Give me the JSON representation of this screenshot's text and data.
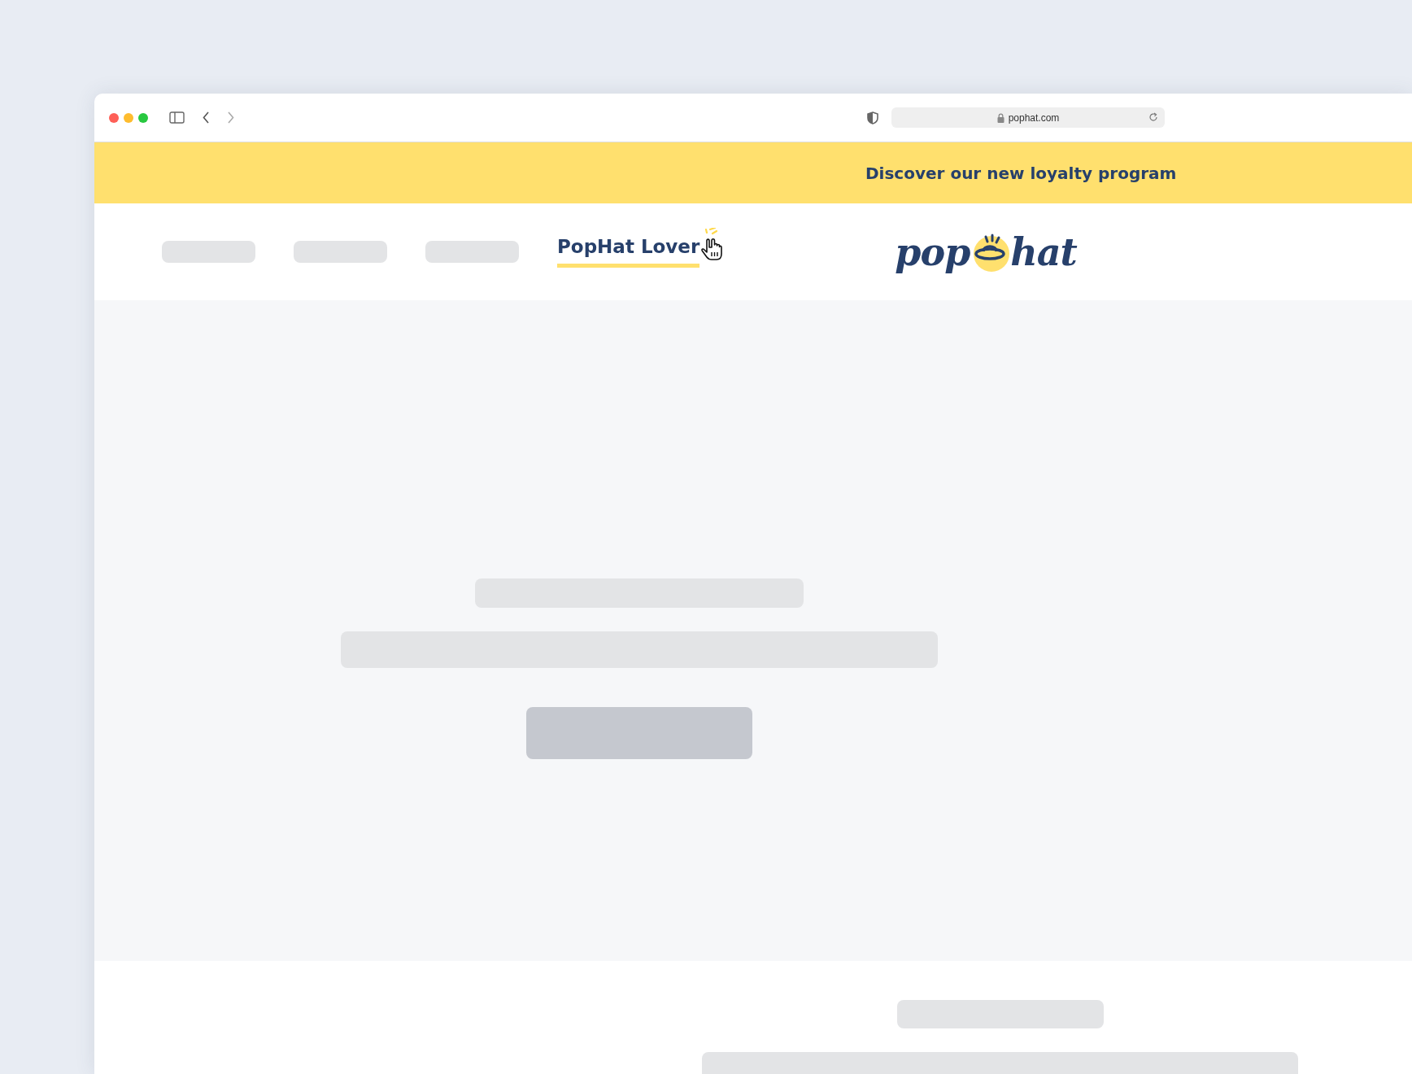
{
  "browser": {
    "url": "pophat.com"
  },
  "banner": {
    "text": "Discover our new loyalty program"
  },
  "nav": {
    "items": [
      {
        "kind": "placeholder"
      },
      {
        "kind": "placeholder"
      },
      {
        "kind": "placeholder"
      },
      {
        "kind": "link",
        "label": "PopHat Lover",
        "selected": true,
        "hovered": true
      }
    ]
  },
  "logo": {
    "left": "pop",
    "right": "hat"
  }
}
